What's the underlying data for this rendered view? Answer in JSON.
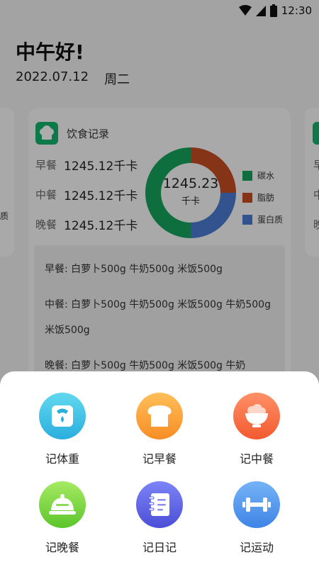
{
  "status_bar": {
    "time": "12:30"
  },
  "header": {
    "greeting": "中午好!",
    "date": "2022.07.12",
    "weekday": "周二"
  },
  "diet_card": {
    "title": "饮食记录",
    "meals": [
      {
        "label": "早餐",
        "value": "1245.12千卡"
      },
      {
        "label": "中餐",
        "value": "1245.12千卡"
      },
      {
        "label": "晚餐",
        "value": "1245.12千卡"
      }
    ],
    "donut": {
      "total": "1245.23",
      "unit": "千卡"
    },
    "details": [
      "早餐: 白萝卜500g  牛奶500g  米饭500g",
      "中餐: 白萝卜500g  牛奶500g  米饭500g  牛奶500g  米饭500g",
      "晚餐: 白萝卜500g  牛奶500g  米饭500g  牛奶"
    ]
  },
  "side_cards": {
    "left_fragment": "质",
    "right_fragments": [
      "早",
      "中",
      "晚"
    ]
  },
  "chart_data": {
    "type": "pie",
    "categories": [
      "碳水",
      "脂肪",
      "蛋白质"
    ],
    "values": [
      50,
      25,
      25
    ],
    "colors": [
      "#17a35b",
      "#c44d22",
      "#4b7bd0"
    ],
    "legend": "right"
  },
  "actions": [
    {
      "label": "记体重",
      "icon": "scale-icon",
      "color_top": "#62d8ef",
      "color_bottom": "#2aaede"
    },
    {
      "label": "记早餐",
      "icon": "bread-icon",
      "color_top": "#ffbf59",
      "color_bottom": "#f88d25"
    },
    {
      "label": "记中餐",
      "icon": "rice-bowl-icon",
      "color_top": "#ff9067",
      "color_bottom": "#f25a2f"
    },
    {
      "label": "记晚餐",
      "icon": "food-cloche-icon",
      "color_top": "#a6ea63",
      "color_bottom": "#5cc52b"
    },
    {
      "label": "记日记",
      "icon": "notebook-icon",
      "color_top": "#7d83f7",
      "color_bottom": "#4b4fd6"
    },
    {
      "label": "记运动",
      "icon": "dumbbell-icon",
      "color_top": "#75b3f7",
      "color_bottom": "#3f84e6"
    }
  ]
}
